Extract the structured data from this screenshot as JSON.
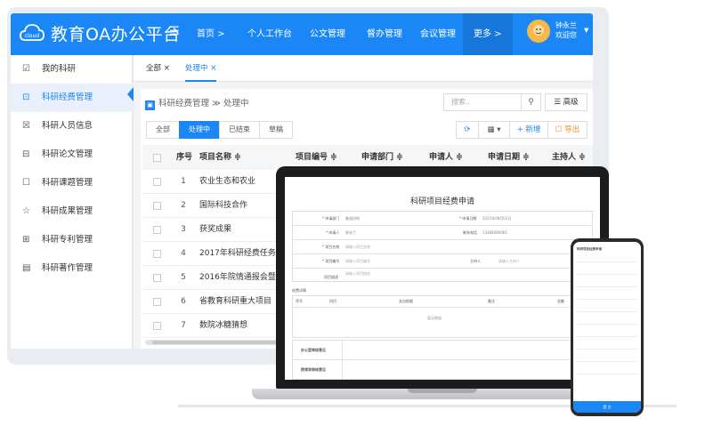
{
  "app": {
    "title": "教育OA办公平台",
    "menu_icon": "hamburger-icon"
  },
  "nav": [
    {
      "label": "首页 >",
      "active": false
    },
    {
      "label": "个人工作台",
      "active": false
    },
    {
      "label": "公文管理",
      "active": false
    },
    {
      "label": "督办管理",
      "active": false
    },
    {
      "label": "会议管理",
      "active": false
    },
    {
      "label": "更多 >",
      "active": true
    }
  ],
  "user": {
    "name": "钟永兰",
    "greeting": "欢迎您"
  },
  "sidebar": [
    {
      "icon": "checkbox-icon",
      "label": "我的科研"
    },
    {
      "icon": "yen-icon",
      "label": "科研经费管理",
      "active": true
    },
    {
      "icon": "person-icon",
      "label": "科研人员信息"
    },
    {
      "icon": "paper-icon",
      "label": "科研论文管理"
    },
    {
      "icon": "topic-icon",
      "label": "科研课题管理"
    },
    {
      "icon": "star-icon",
      "label": "科研成果管理"
    },
    {
      "icon": "patent-icon",
      "label": "科研专利管理"
    },
    {
      "icon": "book-icon",
      "label": "科研著作管理"
    }
  ],
  "tabs": [
    {
      "label": "全部 ×",
      "selected": false
    },
    {
      "label": "处理中 ×",
      "selected": true
    }
  ],
  "breadcrumb": "科研经费管理 ≫ 处理中",
  "search": {
    "placeholder": "搜索..",
    "advanced": "高级"
  },
  "filters": [
    {
      "label": "全部",
      "selected": false
    },
    {
      "label": "处理中",
      "selected": true
    },
    {
      "label": "已结束",
      "selected": false
    },
    {
      "label": "草稿",
      "selected": false
    }
  ],
  "toolbar": {
    "refresh": "⟳",
    "columns": "▦ ▾",
    "add": "+ 新增",
    "export": "导出"
  },
  "table": {
    "headers": [
      "序号",
      "项目名称 ≑",
      "项目编号 ≑",
      "申请部门 ≑",
      "申请人 ≑",
      "申请日期 ≑",
      "主持人 ≑"
    ],
    "rows": [
      {
        "no": "1",
        "name": "农业生态和农业"
      },
      {
        "no": "2",
        "name": "国际科技合作"
      },
      {
        "no": "3",
        "name": "获奖成果"
      },
      {
        "no": "4",
        "name": "2017年科研经费任务书"
      },
      {
        "no": "5",
        "name": "2016年院情通报会暨"
      },
      {
        "no": "6",
        "name": "省教育科研重大项目"
      },
      {
        "no": "7",
        "name": "数院冰糖猜想"
      }
    ]
  },
  "laptop_form": {
    "title": "科研项目经费申请",
    "dept_label": "* 申请部门",
    "dept_value": "鲁迦机构",
    "date_label": "* 申请日期",
    "date_value": "2022年08月03日",
    "applicant_label": "* 申请人",
    "applicant_value": "钟永兰",
    "phone_label": "联系电话",
    "phone_value": "13488080081",
    "pname_label": "* 项目名称",
    "pname_value": "请输入项目名称",
    "pno_label": "* 项目编号",
    "pno_value": "请输入项目编号",
    "host_label": "主持人",
    "host_value": "请输入主持人",
    "desc_label": "项目描述",
    "desc_value": "请输入项目描述",
    "detail_label": "经费详情",
    "detail_headers": [
      "序号",
      "科目",
      "支出依据",
      "备注",
      "金额"
    ],
    "empty": "暂无数据",
    "office_label": "办公室审核意见",
    "dean_label": "院领导审核意见"
  },
  "phone_form": {
    "title": "科研项目经费申请",
    "submit": "提 交"
  }
}
